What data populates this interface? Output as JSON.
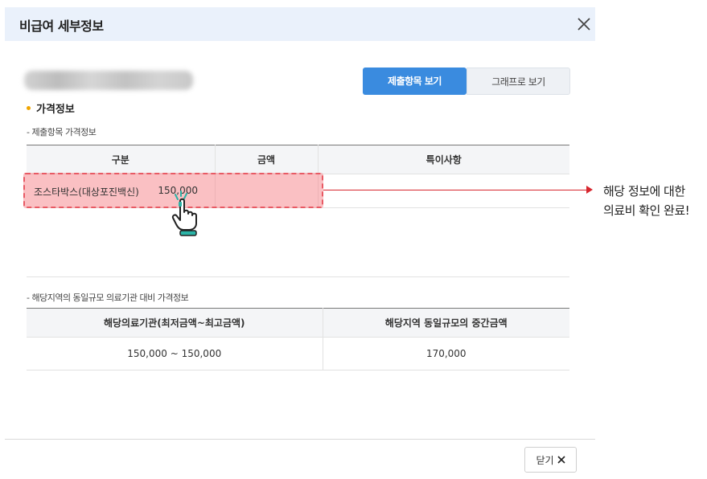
{
  "modal": {
    "title": "비급여 세부정보",
    "close_icon": "close-icon"
  },
  "view_tabs": [
    {
      "label": "제출항목 보기",
      "active": true
    },
    {
      "label": "그래프로 보기",
      "active": false
    }
  ],
  "section": {
    "title": "가격정보"
  },
  "price_table": {
    "subtitle": "- 제출항목 가격정보",
    "headers": [
      "구분",
      "금액",
      "특이사항"
    ],
    "rows": [
      {
        "name": "조스타박스(대상포진백신)",
        "amount": "150,000",
        "note": ""
      }
    ]
  },
  "region_table": {
    "subtitle": "- 해당지역의 동일규모 의료기관 대비 가격정보",
    "headers": [
      "해당의료기관(최저금액~최고금액)",
      "해당지역 동일규모의 중간금액"
    ],
    "rows": [
      {
        "range": "150,000 ~ 150,000",
        "median": "170,000"
      }
    ]
  },
  "annotation": {
    "line1": "해당 정보에 대한",
    "line2": "의료비 확인 완료!"
  },
  "footer": {
    "close_label": "닫기"
  },
  "colors": {
    "accent": "#3a8bdf",
    "highlight": "#f58c91",
    "arrow": "#d7262e",
    "bullet": "#f0a500"
  }
}
